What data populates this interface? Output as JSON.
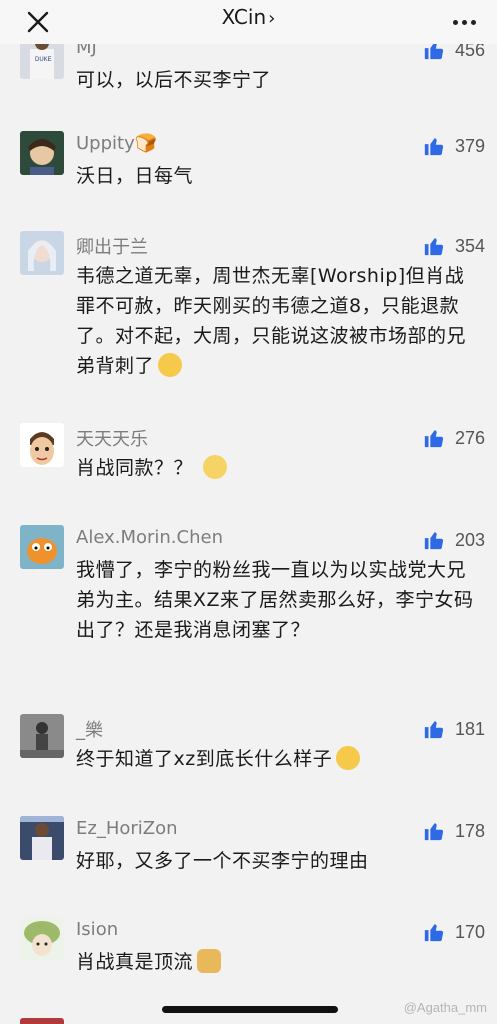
{
  "header": {
    "title": "XCin",
    "chevron": "›"
  },
  "comments": [
    {
      "name": "MJ",
      "likes": "456",
      "text": "可以，以后不买李宁了"
    },
    {
      "name": "Uppity🍞",
      "likes": "379",
      "text": "沃日，日每气"
    },
    {
      "name": "卿出于兰",
      "likes": "354",
      "text": "韦德之道无辜，周世杰无辜[Worship]但肖战罪不可赦，昨天刚买的韦德之道8，只能退款了。对不起，大周，只能说这波被市场部的兄弟背刺了"
    },
    {
      "name": "天天天乐",
      "likes": "276",
      "text": "肖战同款？？"
    },
    {
      "name": "Alex.Morin.Chen",
      "likes": "203",
      "text": "我懵了，李宁的粉丝我一直以为以实战党大兄弟为主。结果XZ来了居然卖那么好，李宁女码出了？还是我消息闭塞了？"
    },
    {
      "name": "_樂",
      "likes": "181",
      "text": "终于知道了xz到底长什么样子"
    },
    {
      "name": "Ez_HoriZon",
      "likes": "178",
      "text": "好耶，又多了一个不买李宁的理由"
    },
    {
      "name": "Ision",
      "likes": "170",
      "text": "肖战真是顶流"
    }
  ],
  "watermark": "@Agatha_mm",
  "colors": {
    "background": "#f2f2f2",
    "like_icon": "#2f6ae6",
    "name": "#7d7d7d"
  }
}
